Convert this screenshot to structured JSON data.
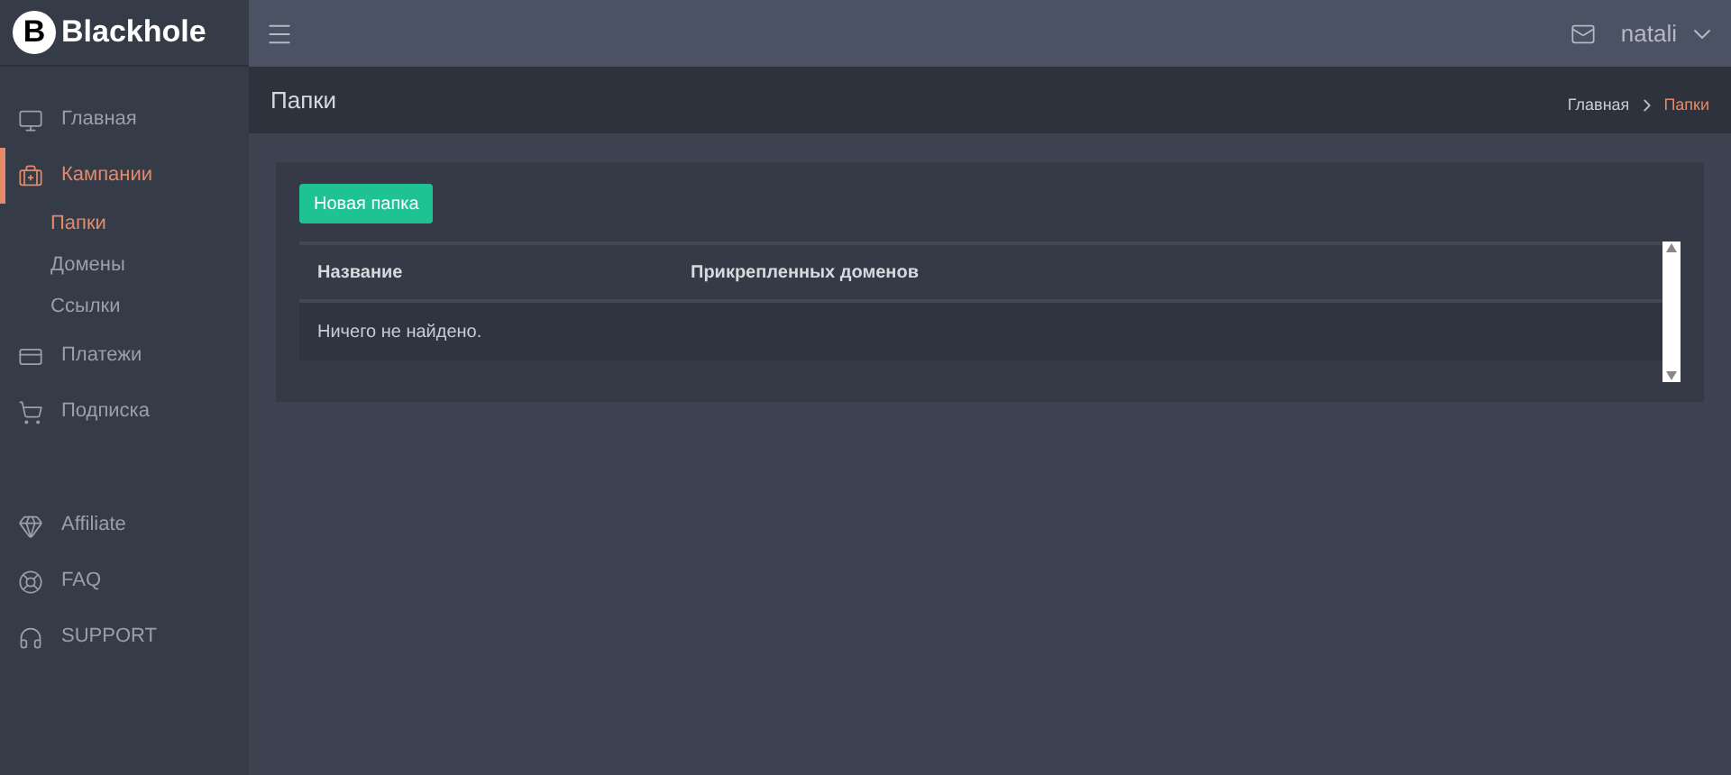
{
  "brand": {
    "logo_letter": "B",
    "name": "Blackhole"
  },
  "header": {
    "user": "natali"
  },
  "sidebar": {
    "items": [
      {
        "label": "Главная",
        "selected": false
      },
      {
        "label": "Кампании",
        "selected": true,
        "children": [
          {
            "label": "Папки",
            "selected": true
          },
          {
            "label": "Домены",
            "selected": false
          },
          {
            "label": "Ссылки",
            "selected": false
          }
        ]
      },
      {
        "label": "Платежи",
        "selected": false
      },
      {
        "label": "Подписка",
        "selected": false
      }
    ],
    "extra_items": [
      {
        "label": "Affiliate",
        "selected": false
      },
      {
        "label": "FAQ",
        "selected": false
      },
      {
        "label": "SUPPORT",
        "selected": false
      }
    ]
  },
  "page": {
    "title": "Папки",
    "breadcrumbs": [
      {
        "label": "Главная",
        "selected": false
      },
      {
        "label": "Папки",
        "selected": true
      }
    ]
  },
  "button": "Новая папка",
  "table": {
    "columns": [
      "Название",
      "Прикрепленных доменов"
    ],
    "empty_message": "Ничего не найдено."
  }
}
